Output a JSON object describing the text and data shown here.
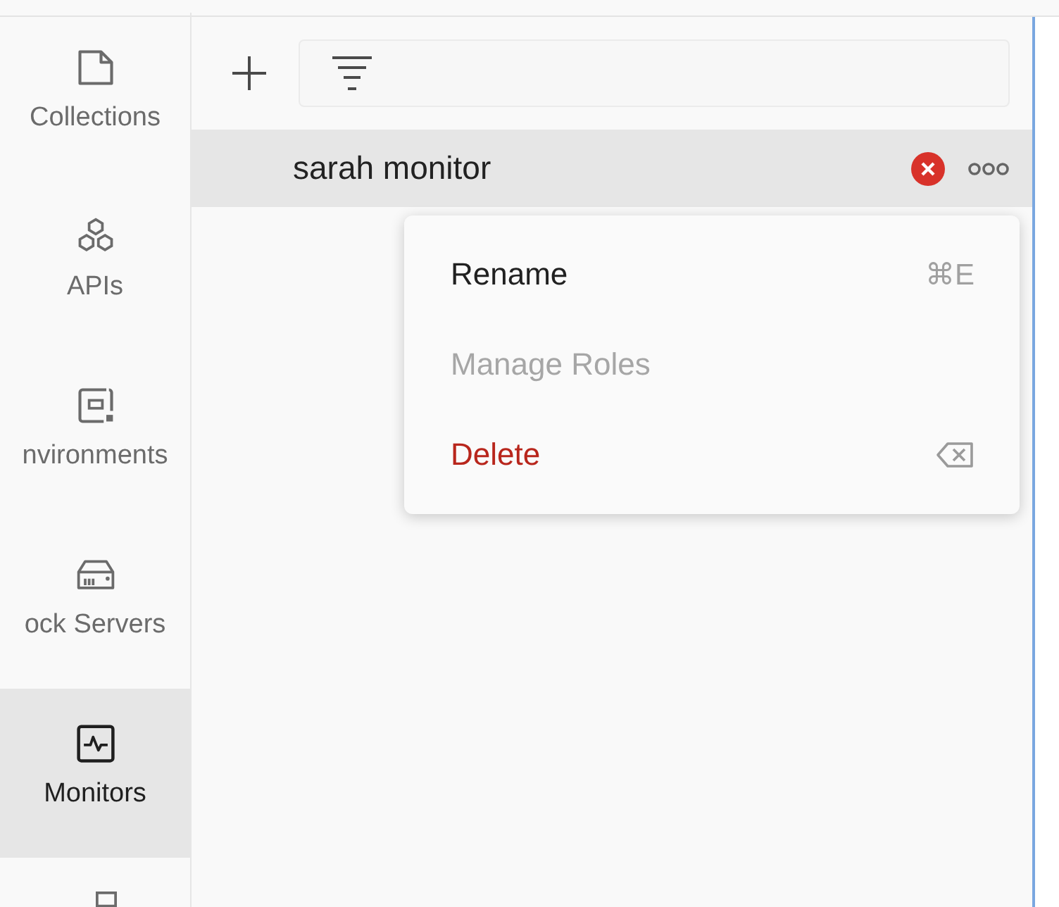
{
  "sidebar": {
    "items": [
      {
        "kind": "collections",
        "label": "Collections",
        "selected": false
      },
      {
        "kind": "apis",
        "label": "APIs",
        "selected": false
      },
      {
        "kind": "environments",
        "label": "nvironments",
        "selected": false
      },
      {
        "kind": "mock",
        "label": "ock Servers",
        "selected": false
      },
      {
        "kind": "monitors",
        "label": "Monitors",
        "selected": true
      },
      {
        "kind": "flows",
        "selected": false
      }
    ]
  },
  "list": {
    "rows": [
      {
        "name": "sarah monitor",
        "error": true,
        "selected": true
      }
    ]
  },
  "context_menu": {
    "items": [
      {
        "kind": "normal",
        "label": "Rename",
        "shortcut": "⌘E",
        "disabled": false
      },
      {
        "kind": "normal",
        "label": "Manage Roles",
        "disabled": true
      },
      {
        "kind": "danger",
        "label": "Delete",
        "disabled": false
      }
    ]
  }
}
